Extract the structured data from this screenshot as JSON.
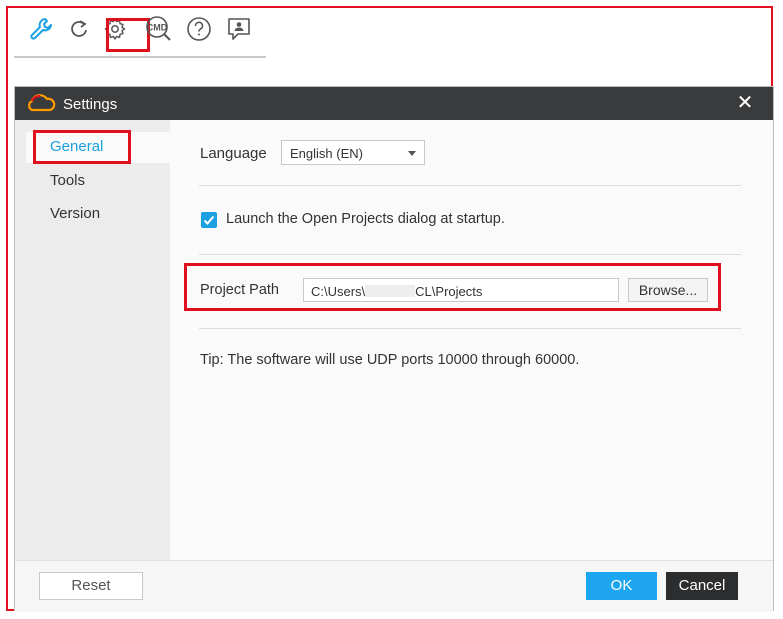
{
  "toolbar": {
    "icons": [
      "wrench-icon",
      "refresh-icon",
      "gear-icon",
      "cmd-search-icon",
      "help-icon",
      "feedback-icon"
    ],
    "cmd_text": "CMD"
  },
  "dialog": {
    "title": "Settings",
    "close_glyph": "✕",
    "nav": [
      {
        "label": "General",
        "active": true
      },
      {
        "label": "Tools",
        "active": false
      },
      {
        "label": "Version",
        "active": false
      }
    ],
    "general": {
      "language_label": "Language",
      "language_value": "English (EN)",
      "startup_checkbox_label": "Launch the Open Projects dialog at startup.",
      "startup_checked": true,
      "project_path_label": "Project Path",
      "project_path_prefix": "C:\\Users\\",
      "project_path_suffix": "CL\\Projects",
      "browse_label": "Browse...",
      "tip": "Tip: The software will use UDP ports 10000 through 60000."
    },
    "footer": {
      "reset_label": "Reset",
      "ok_label": "OK",
      "cancel_label": "Cancel"
    }
  },
  "colors": {
    "accent": "#1ba1e2",
    "highlight": "#e0101e",
    "titlebar": "#3a3b3d"
  }
}
